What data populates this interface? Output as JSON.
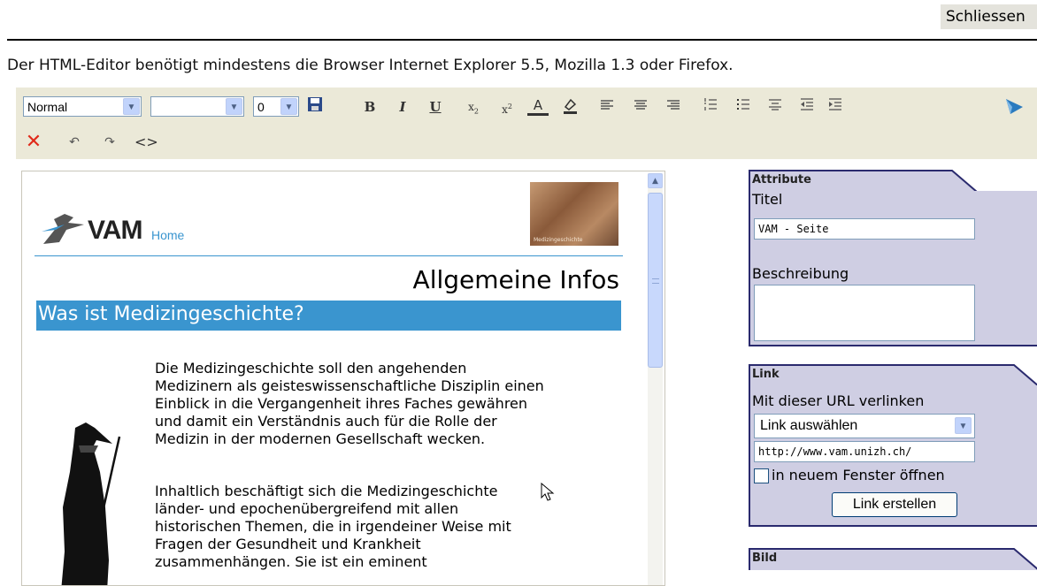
{
  "header": {
    "close_label": "Schliessen"
  },
  "notice": "Der HTML-Editor benötigt mindestens die Browser Internet Explorer 5.5, Mozilla 1.3 oder Firefox.",
  "toolbar": {
    "format_select": "Normal",
    "font_select": "",
    "size_select": "0",
    "icons": [
      "save-icon",
      "bold-icon",
      "italic-icon",
      "underline-icon",
      "subscript-icon",
      "superscript-icon",
      "text-color-icon",
      "highlight-icon",
      "align-left-icon",
      "align-center-icon",
      "align-right-icon",
      "ordered-list-icon",
      "unordered-list-icon",
      "justify-icon",
      "outdent-icon",
      "indent-icon",
      "link-icon",
      "delete-icon",
      "undo-icon",
      "redo-icon",
      "source-icon"
    ]
  },
  "content": {
    "logo_text": "VAM",
    "logo_home": "Home",
    "image_caption": "Medizingeschichte",
    "heading": "Allgemeine Infos",
    "title": "Was ist Medizingeschichte?",
    "paragraph1": "Die Medizingeschichte soll den angehenden\nMedizinern als geisteswissenschaftliche Disziplin einen\nEinblick in die Vergangenheit ihres Faches gewähren\nund damit ein Verständnis auch für die Rolle der\nMedizin in der modernen Gesellschaft wecken.",
    "paragraph2": "Inhaltlich beschäftigt sich die Medizingeschichte\nländer- und epochenübergreifend mit allen\nhistorischen Themen, die in irgendeiner Weise mit\nFragen der Gesundheit und Krankheit\nzusammenhängen. Sie ist ein eminent"
  },
  "attribute_panel": {
    "header": "Attribute",
    "title_label": "Titel",
    "title_value": "VAM - Seite",
    "description_label": "Beschreibung"
  },
  "link_panel": {
    "header": "Link",
    "url_label": "Mit dieser URL verlinken",
    "select_value": "Link auswählen",
    "url_value": "http://www.vam.unizh.ch/",
    "new_window_label": "in neuem Fenster öffnen",
    "create_button": "Link erstellen"
  },
  "image_panel": {
    "header": "Bild"
  },
  "colors": {
    "accent": "#3a95cf",
    "toolbar_bg": "#ebe9d8",
    "panel_bg": "#cfcee3",
    "panel_border": "#2a2a6e"
  }
}
